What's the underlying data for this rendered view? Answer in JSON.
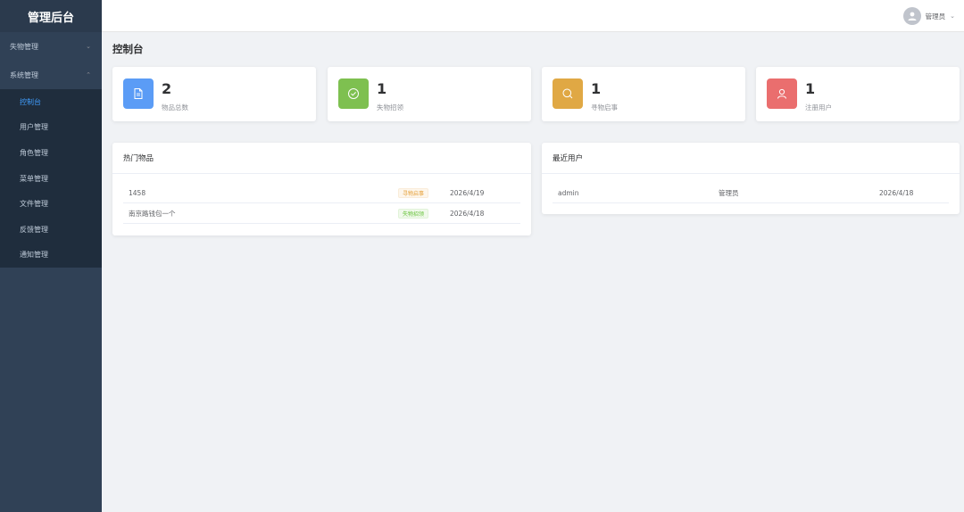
{
  "sidebar": {
    "brand": "管理后台",
    "groups": [
      {
        "label": "失物管理",
        "chevron": "⌄"
      },
      {
        "label": "系统管理",
        "chevron": "⌃"
      }
    ],
    "items": [
      {
        "label": "控制台"
      },
      {
        "label": "用户管理"
      },
      {
        "label": "角色管理"
      },
      {
        "label": "菜单管理"
      },
      {
        "label": "文件管理"
      },
      {
        "label": "反馈管理"
      },
      {
        "label": "通知管理"
      }
    ]
  },
  "header": {
    "user_name": "管理员",
    "chevron": "⌄"
  },
  "main": {
    "title": "控制台",
    "stats": [
      {
        "value": "2",
        "label": "物品总数",
        "color": "#5b9cf6",
        "icon": "document-icon"
      },
      {
        "value": "1",
        "label": "失物招领",
        "color": "#7ec050",
        "icon": "check-circle-icon"
      },
      {
        "value": "1",
        "label": "寻物启事",
        "color": "#e0a844",
        "icon": "search-icon"
      },
      {
        "value": "1",
        "label": "注册用户",
        "color": "#ea6e6e",
        "icon": "user-icon"
      }
    ],
    "hot_items": {
      "title": "热门物品",
      "rows": [
        {
          "name": "1458",
          "tag": "寻物启事",
          "date": "2026/4/19"
        },
        {
          "name": "南京路钱包一个",
          "tag": "失物招领",
          "date": "2026/4/18"
        }
      ]
    },
    "recent_users": {
      "title": "最近用户",
      "rows": [
        {
          "username": "admin",
          "role": "管理员",
          "date": "2026/4/18"
        }
      ]
    }
  }
}
